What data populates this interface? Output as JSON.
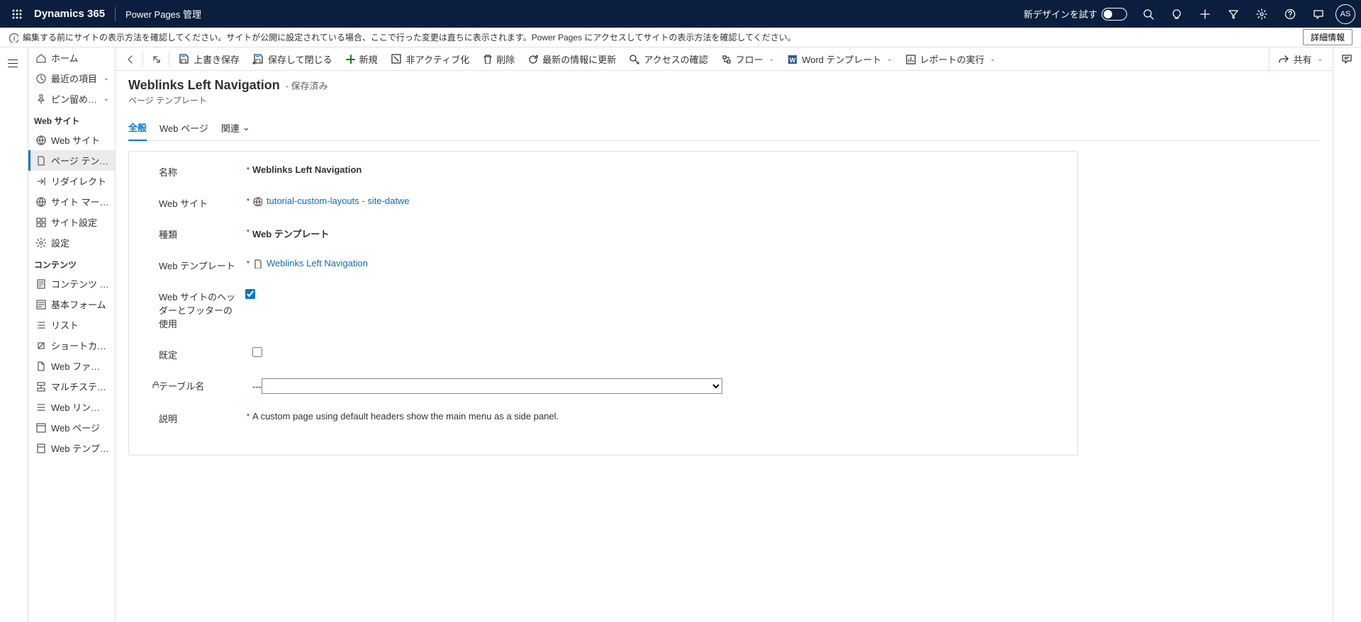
{
  "topbar": {
    "brand": "Dynamics 365",
    "app_name": "Power Pages 管理",
    "try_new": "新デザインを試す",
    "avatar_initials": "AS"
  },
  "infobar": {
    "message": "編集する前にサイトの表示方法を確認してください。サイトが公開に設定されている場合、ここで行った変更は直ちに表示されます。Power Pages にアクセスしてサイトの表示方法を確認してください。",
    "detail_btn": "詳細情報"
  },
  "leftnav": {
    "items_top": [
      {
        "icon": "home",
        "label": "ホーム"
      },
      {
        "icon": "clock",
        "label": "最近の項目",
        "chevron": true
      },
      {
        "icon": "pin",
        "label": "ピン留め済み",
        "chevron": true
      }
    ],
    "section_web": "Web サイト",
    "items_web": [
      {
        "icon": "globe",
        "label": "Web サイト"
      },
      {
        "icon": "page",
        "label": "ページ テンプレ...",
        "selected": true
      },
      {
        "icon": "redirect",
        "label": "リダイレクト"
      },
      {
        "icon": "globe",
        "label": "サイト マーカー"
      },
      {
        "icon": "settings-grid",
        "label": "サイト設定"
      },
      {
        "icon": "gear",
        "label": "設定"
      }
    ],
    "section_content": "コンテンツ",
    "items_content": [
      {
        "icon": "snippet",
        "label": "コンテンツ スニ..."
      },
      {
        "icon": "form",
        "label": "基本フォーム"
      },
      {
        "icon": "list",
        "label": "リスト"
      },
      {
        "icon": "shortcut",
        "label": "ショートカット"
      },
      {
        "icon": "file",
        "label": "Web ファイル"
      },
      {
        "icon": "multistep",
        "label": "マルチステップ ..."
      },
      {
        "icon": "linkset",
        "label": "Web リンク セット"
      },
      {
        "icon": "webpage",
        "label": "Web ページ"
      },
      {
        "icon": "template",
        "label": "Web テンプレート"
      }
    ]
  },
  "cmdbar": {
    "save": "上書き保存",
    "saveclose": "保存して閉じる",
    "new": "新規",
    "deactivate": "非アクティブ化",
    "delete": "削除",
    "refresh": "最新の情報に更新",
    "access": "アクセスの確認",
    "flow": "フロー",
    "word": "Word テンプレート",
    "report": "レポートの実行",
    "share": "共有"
  },
  "record": {
    "title": "Weblinks Left Navigation",
    "status": "- 保存済み",
    "entity": "ページ テンプレート"
  },
  "tabs": {
    "general": "全般",
    "webpages": "Web ページ",
    "related": "関連"
  },
  "form": {
    "name_label": "名称",
    "name_value": "Weblinks Left Navigation",
    "website_label": "Web サイト",
    "website_value": "tutorial-custom-layouts - site-datwe",
    "type_label": "種類",
    "type_value": "Web テンプレート",
    "webtemplate_label": "Web テンプレート",
    "webtemplate_value": "Weblinks Left Navigation",
    "useheader_label": "Web サイトのヘッダーとフッターの使用",
    "useheader_value": true,
    "isdefault_label": "既定",
    "isdefault_value": false,
    "tablename_label": "テーブル名",
    "tablename_value": "---",
    "desc_label": "説明",
    "desc_value": "A custom page using default headers show the main menu as a side panel."
  }
}
